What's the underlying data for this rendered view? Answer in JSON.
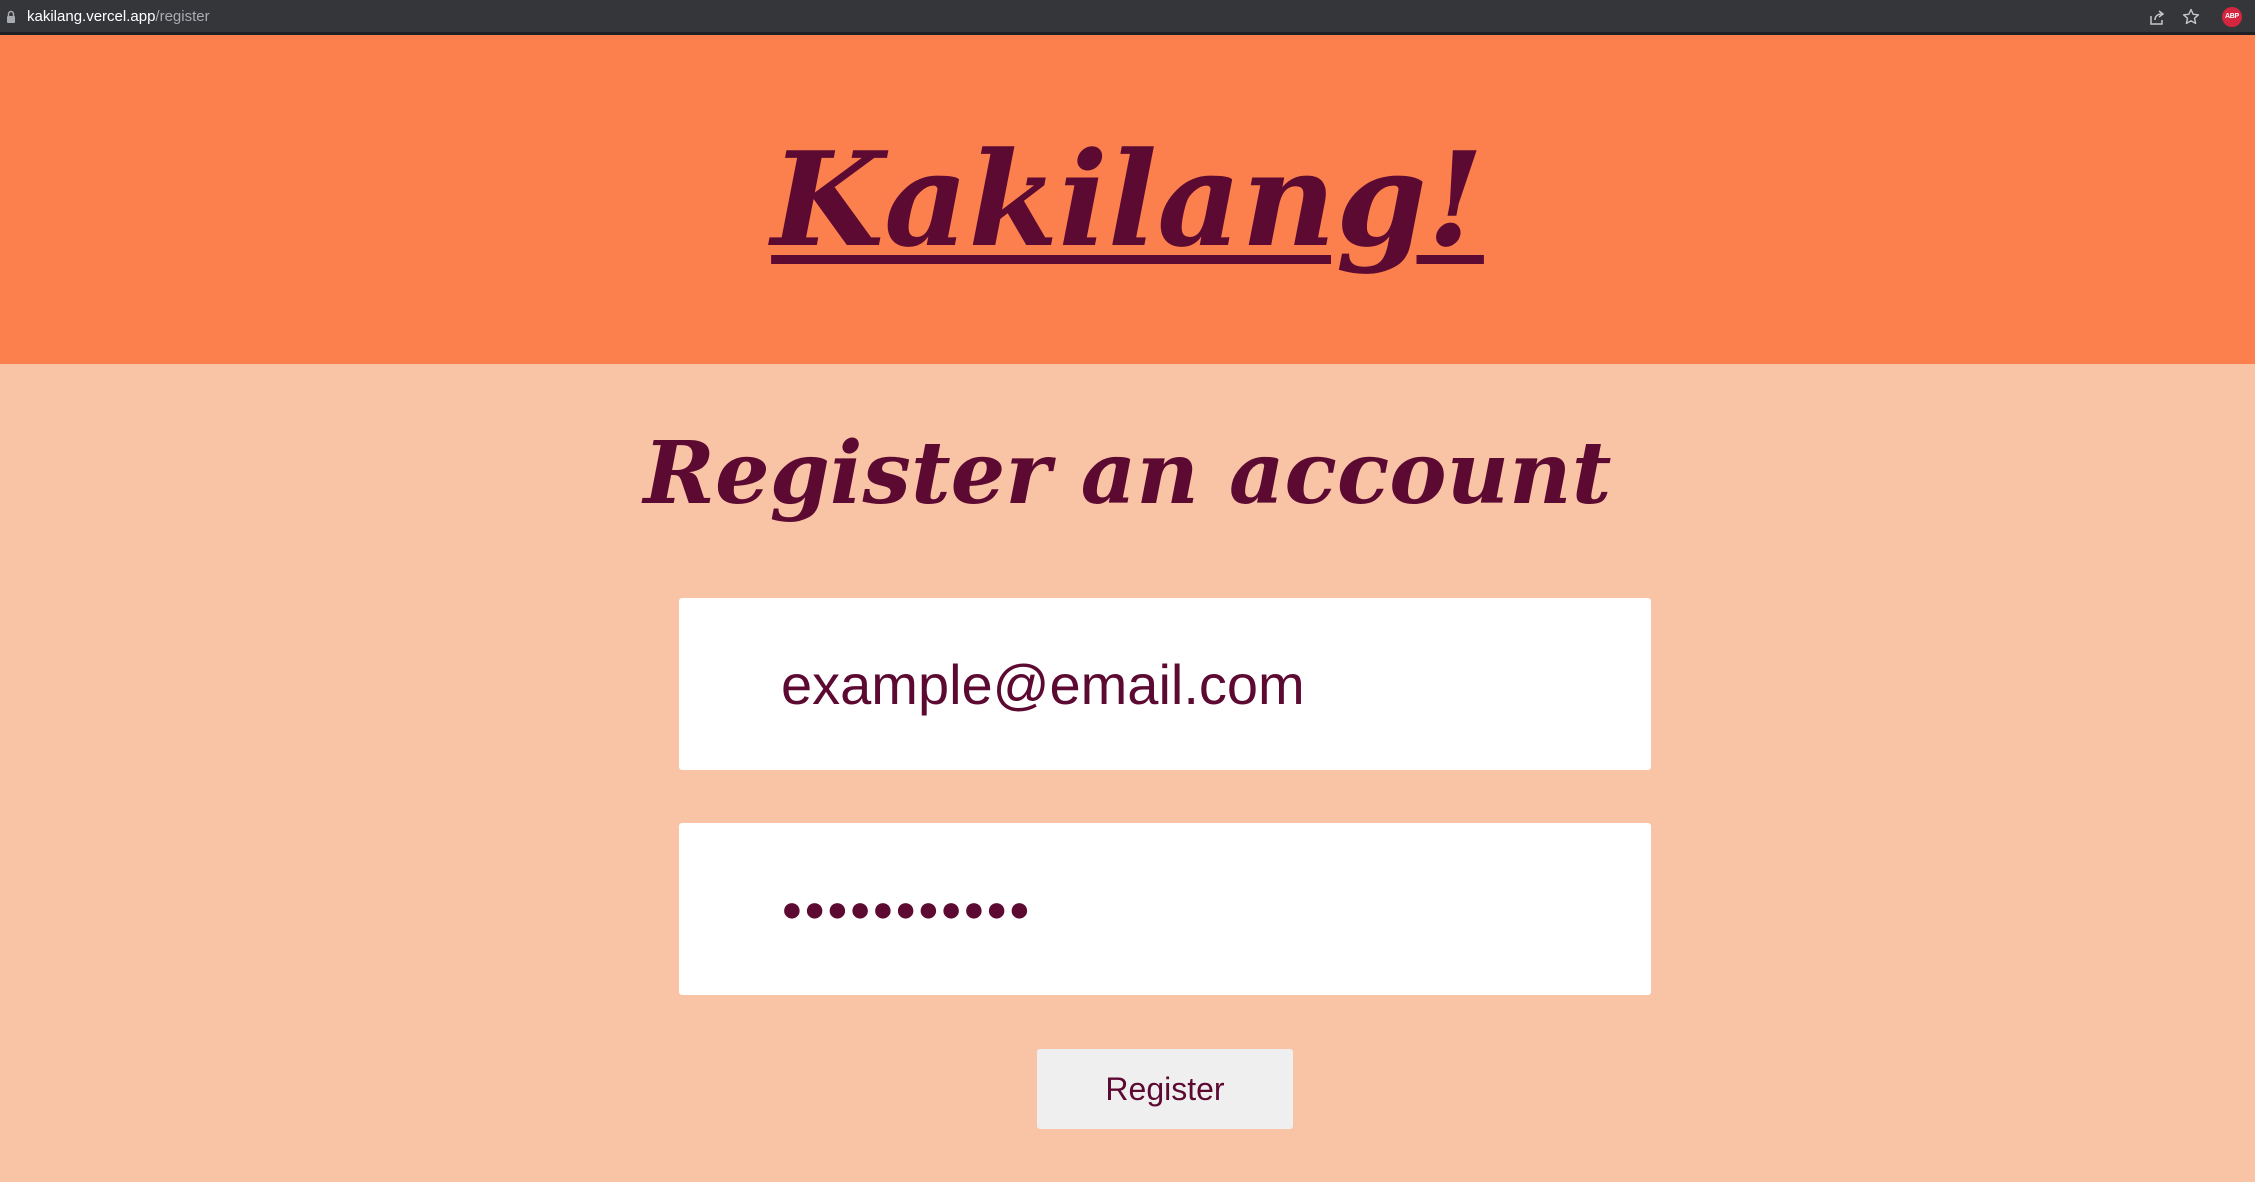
{
  "browser": {
    "url_host": "kakilang.vercel.app",
    "url_path": "/register",
    "icons": [
      "lock-icon",
      "share-icon",
      "star-icon",
      "adblock-extension-icon"
    ],
    "extension_badge": "ABP"
  },
  "header": {
    "logo_text": "Kakilang!",
    "background_color": "#fc804d",
    "text_color": "#5c0a32"
  },
  "main": {
    "background_color": "#f9c3a6",
    "title": "Register an account",
    "email_field": {
      "value": "example@email.com"
    },
    "password_field": {
      "value": "●●●●●●●●●●●"
    },
    "register_label": "Register"
  }
}
